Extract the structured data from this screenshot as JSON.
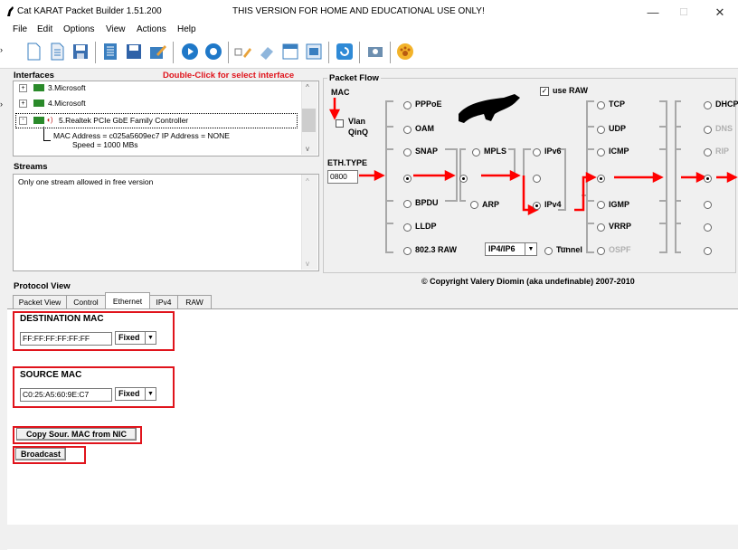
{
  "window": {
    "title": "Cat KARAT Packet Builder 1.51.200",
    "banner": "THIS VERSION FOR HOME AND EDUCATIONAL USE ONLY!",
    "controls": [
      "—",
      "☐",
      "✕"
    ]
  },
  "menu": [
    "File",
    "Edit",
    "Options",
    "View",
    "Actions",
    "Help"
  ],
  "toolbar": {
    "icons": [
      "new-file-icon",
      "open-file-icon",
      "save-icon",
      "list-icon",
      "save-as-icon",
      "edit-icon",
      "play-icon",
      "stop-icon",
      "checkbox-edit-icon",
      "eraser-icon",
      "calendar-icon",
      "document-icon",
      "refresh-icon",
      "camera-icon",
      "cat-paw-icon"
    ]
  },
  "interfaces": {
    "label": "Interfaces",
    "hint": "Double-Click for select interface",
    "items": [
      "3.Microsoft",
      "4.Microsoft",
      "5.Realtek PCIe GbE Family Controller"
    ],
    "details": [
      "MAC Address = c025a5609ec7  IP Address = NONE",
      "Speed = 1000 MBs"
    ]
  },
  "streams": {
    "label": "Streams",
    "message": "Only one stream allowed in free version"
  },
  "packet_flow": {
    "label": "Packet Flow",
    "mac": "MAC",
    "vlan": "Vlan",
    "qinq": "QinQ",
    "eth_type_label": "ETH.TYPE",
    "eth_type_value": "0800",
    "use_raw": "use RAW",
    "col1": [
      "PPPoE",
      "OAM",
      "SNAP",
      "",
      "BPDU",
      "LLDP",
      "802.3 RAW"
    ],
    "col2": [
      "MPLS",
      "",
      "ARP"
    ],
    "col3": [
      "IPv6",
      "",
      "IPv4",
      "Tunnel"
    ],
    "ip_combo": "IP4/IP6",
    "col4": [
      "TCP",
      "UDP",
      "ICMP",
      "",
      "IGMP",
      "VRRP",
      "OSPF"
    ],
    "col5": [
      "DHCP",
      "DNS",
      "RIP"
    ],
    "copyright": "© Copyright Valery Diomin (aka undefinable) 2007-2010"
  },
  "protocol_view": {
    "label": "Protocol View",
    "tabs": [
      "Packet View",
      "Control",
      "Ethernet",
      "IPv4",
      "RAW"
    ],
    "active_tab": "Ethernet"
  },
  "ethernet": {
    "dest_label": "DESTINATION MAC",
    "dest_value": "FF:FF:FF:FF:FF:FF",
    "dest_mode": "Fixed",
    "src_label": "SOURCE MAC",
    "src_value": "C0:25:A5:60:9E:C7",
    "src_mode": "Fixed",
    "copy_button": "Copy Sour. MAC from NIC",
    "broadcast_button": "Broadcast"
  },
  "colors": {
    "highlight_red": "#e0141c",
    "hint_red": "#e0141c",
    "flow_arrow_red": "#ff0000",
    "flow_line_gray": "#a8a8a8"
  }
}
